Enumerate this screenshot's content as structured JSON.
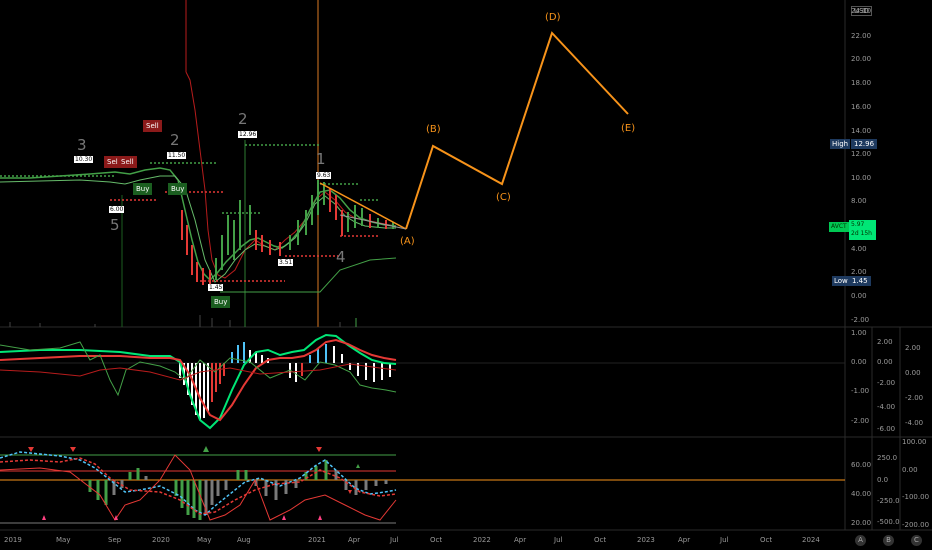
{
  "axis": {
    "currency": "USD",
    "main_ticks": [
      "24.00",
      "22.00",
      "20.00",
      "18.00",
      "16.00",
      "14.00",
      "12.00",
      "10.00",
      "8.00",
      "6.00",
      "4.00",
      "2.00",
      "0.00",
      "-2.00"
    ],
    "main_tick_y": [
      12,
      37,
      60,
      84,
      108,
      132,
      155,
      179,
      202,
      226,
      250,
      273,
      297,
      321
    ],
    "macd_right": [
      "1.00",
      "0.00",
      "-1.00",
      "-2.00"
    ],
    "macd_right_y": [
      334,
      363,
      392,
      422
    ],
    "macd_mid": [
      "2.00",
      "0.00",
      "-2.00",
      "-4.00",
      "-6.00"
    ],
    "macd_mid_y": [
      343,
      363,
      384,
      408,
      430
    ],
    "macd_far": [
      "2.00",
      "0.00",
      "-2.00",
      "-4.00"
    ],
    "macd_far_y": [
      349,
      374,
      399,
      424
    ],
    "osc_right": [
      "60.00",
      "40.00",
      "20.00"
    ],
    "osc_right_y": [
      466,
      495,
      524
    ],
    "osc_mid": [
      "250.0",
      "0.0",
      "-250.0",
      "-500.0"
    ],
    "osc_mid_y": [
      459,
      481,
      502,
      523
    ],
    "osc_far": [
      "100.00",
      "0.00",
      "-100.00",
      "-200.00"
    ],
    "osc_far_y": [
      443,
      471,
      498,
      526
    ],
    "time": [
      "2019",
      "May",
      "Sep",
      "2020",
      "May",
      "Aug",
      "2021",
      "Apr",
      "Jul",
      "Oct",
      "2022",
      "Apr",
      "Jul",
      "Oct",
      "2023",
      "Apr",
      "Jul",
      "Oct",
      "2024"
    ],
    "time_x": [
      12,
      64,
      116,
      160,
      205,
      245,
      316,
      356,
      398,
      438,
      481,
      522,
      562,
      602,
      645,
      686,
      728,
      768,
      810
    ]
  },
  "price_labels": {
    "high_label": "High",
    "high_value": "12.96",
    "last_ticker": "AVCT",
    "last_value": "5.97",
    "last_countdown": "2d 15h",
    "low_label": "Low",
    "low_value": "1.45"
  },
  "wave_labels": {
    "a": "(A)",
    "b": "(B)",
    "c": "(C)",
    "d": "(D)",
    "e": "(E)",
    "w3": "3",
    "w5": "5",
    "w2a": "2",
    "w2b": "2",
    "w1": "1",
    "w4": "4"
  },
  "signals": {
    "sell1": "Sell",
    "sell2": "Sell",
    "sell3": "Sell",
    "buy1": "Buy",
    "buy2": "Buy",
    "buy3": "Buy"
  },
  "price_tags": {
    "p1": "10.30",
    "p2": "11.50",
    "p3": "6.00",
    "p4": "12.96",
    "p5": "9.63",
    "p6": "1.45",
    "p7": "3.51"
  },
  "bottom_buttons": {
    "a": "A",
    "b": "B",
    "c": "C"
  },
  "colors": {
    "orange": "#f7931a",
    "green": "#22c55e",
    "red": "#e53935",
    "highlight": "#1e3a5f",
    "bg": "#000000"
  }
}
